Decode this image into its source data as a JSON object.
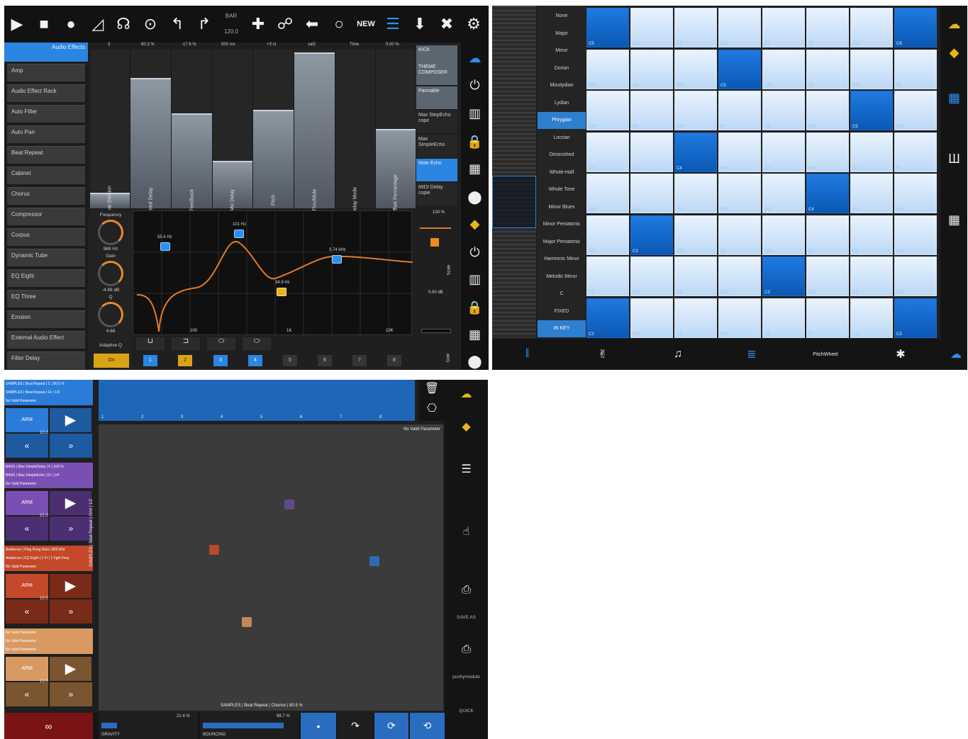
{
  "panel1": {
    "toolbar": {
      "play": "▶",
      "stop": "■",
      "record": "●",
      "metronome": "◿",
      "headphones": "☊",
      "play_circle": "⊙",
      "undo": "↰",
      "redo": "↱",
      "tempo_label": "BAR",
      "tempo_value": "120.0",
      "add": "✚",
      "link": "☍",
      "back": "⬅",
      "circle": "○",
      "new": "NEW",
      "list": "☰",
      "download": "⬇",
      "close": "✖",
      "settings": "⚙"
    },
    "device_list": {
      "header": "Audio Effects",
      "items": [
        "Amp",
        "Audio Effect Rack",
        "Auto Filter",
        "Auto Pan",
        "Beat Repeat",
        "Cabinet",
        "Chorus",
        "Compressor",
        "Corpus",
        "Dynamic Tube",
        "EQ Eight",
        "EQ Three",
        "Erosion",
        "External Audio Effect",
        "Filter Delay"
      ]
    },
    "param_values": [
      "3",
      "80.3 %",
      "-17.6 %",
      "500 ms",
      "+3 st",
      "val2",
      "Time",
      "0.00 %"
    ],
    "param_names": [
      "Beat Division",
      "Feed Delay",
      "Feedback",
      "Mix Delay",
      "Pitch",
      "Thru/Mute",
      "Delay Mode",
      "Beat Offset Percentage"
    ],
    "param_levels": [
      0.1,
      0.82,
      0.6,
      0.3,
      0.62,
      0.98,
      0.0,
      0.5
    ],
    "side_buttons": [
      "KICK",
      "THEME COMPOSER",
      "Pannable",
      "Max StepEcho cope",
      "Max SimpleEcho",
      "Note Echo",
      "MIDI Delay copie"
    ],
    "knobs": [
      {
        "label": "Frequency",
        "value": "969 Hz"
      },
      {
        "label": "Gain",
        "value": "-4.98 dB"
      },
      {
        "label": "Q",
        "value": "4.66"
      }
    ],
    "adaptive": "Adaptive Q",
    "eq_labels": {
      "f1": "55.4 Hz",
      "f2": "101 Hz",
      "f3": "34.9 Hz",
      "f4": "3.74 kHz",
      "x100": "100",
      "x1k": "1K",
      "x10k": "10K"
    },
    "right_values": {
      "top": "100 %",
      "mid": "0.00 dB",
      "scale": "Scale",
      "gain": "Gain"
    },
    "filter_icons": [
      "⊔",
      "⊐",
      "⬭",
      "⬭"
    ],
    "band_numbers": [
      "1",
      "2",
      "3",
      "4",
      "5",
      "6",
      "7",
      "8"
    ],
    "on_label": "On",
    "side_icons": [
      "☁",
      "⏻",
      "▥",
      "🔒",
      "▦",
      "⬤",
      "◆",
      "⏻",
      "▥",
      "🔒",
      "▦",
      "⬤"
    ]
  },
  "panel2": {
    "scales": [
      "None",
      "Major",
      "Minor",
      "Dorian",
      "Mixolydian",
      "Lydian",
      "Phrygian",
      "Locrian",
      "Diminished",
      "Whole-Half",
      "Whole Tone",
      "Minor Blues",
      "Minor Pentatonic",
      "Major Pentatonic",
      "Harmonic Minor",
      "Melodic Minor",
      "C",
      "FIXED",
      "IN KEY"
    ],
    "selected_scale": "Phrygian",
    "grid_rows": [
      [
        "C5",
        "C#5",
        "D5",
        "D#5",
        "E5",
        "F5",
        "F#5",
        "C6"
      ],
      [
        "F#4",
        "G4",
        "G#4",
        "C5",
        "C#5",
        "D5",
        "D#5",
        "E5"
      ],
      [
        "C#4",
        "D4",
        "D#4",
        "E4",
        "F4",
        "F#4",
        "C5",
        "G#4"
      ],
      [
        "G#3",
        "A3",
        "C4",
        "C#4",
        "D4",
        "D#4",
        "E4",
        "F4"
      ],
      [
        "D#3",
        "E3",
        "F3",
        "F#3",
        "G3",
        "C4",
        "A3",
        "A#3"
      ],
      [
        "A#2",
        "C3",
        "C#3",
        "D3",
        "D#3",
        "E3",
        "F3",
        "F#3"
      ],
      [
        "F2",
        "F#2",
        "G2",
        "G#2",
        "C3",
        "A#2",
        "B2",
        "C#3"
      ],
      [
        "C2",
        "C#2",
        "D2",
        "D#2",
        "E2",
        "F2",
        "F#2",
        "C3"
      ]
    ],
    "on_cells": [
      [
        0,
        0
      ],
      [
        0,
        7
      ],
      [
        1,
        3
      ],
      [
        2,
        6
      ],
      [
        3,
        2
      ],
      [
        4,
        5
      ],
      [
        5,
        1
      ],
      [
        6,
        4
      ],
      [
        7,
        0
      ],
      [
        7,
        7
      ]
    ],
    "bottom": [
      "𝄃",
      "✌",
      "♫",
      "≣",
      "PitchWheel",
      "✱",
      "☁"
    ],
    "right_icons": [
      "☁",
      "◆",
      "▦",
      "Ш",
      "▦"
    ]
  },
  "panel3": {
    "tracks": [
      {
        "line1": "SAMPLES | Beat Repeat | C | 80.5 %",
        "line2": "SAMPLES | Beat Repeat | Gr | 1/2",
        "line3": "No Valid Parameter",
        "arm": "ARM",
        "val": "10.2",
        "color": "#2a7cd8",
        "dark": "#1d5aa0"
      },
      {
        "line1": "BASS | Max SimpleDelay | F | 100 %",
        "line2": "BASS | Max SimpleEcho | Dr | 1/4",
        "line3": "No Valid Parameter",
        "arm": "ARM",
        "val": "21.0",
        "color": "#7a4fb4",
        "dark": "#4b2f72"
      },
      {
        "line1": "Ambience | Ping Pong Dela | 800 kHz",
        "line2": "Ambience | EQ Eight | 1 Fr | 1 Fght Freq",
        "line3": "No Valid Parameter",
        "arm": "ARM",
        "val": "10.0",
        "color": "#c4482a",
        "dark": "#7a2a18"
      },
      {
        "line1": "No Valid Parameter",
        "line2": "No Valid Parameter",
        "line3": "No Valid Parameter",
        "arm": "ARM",
        "val": "21.0",
        "color": "#d89a62",
        "dark": "#7a5530"
      }
    ],
    "ruler": [
      "1",
      "2",
      "3",
      "4",
      "5",
      "6",
      "7",
      "8"
    ],
    "pad_top": "No Valid Parameter",
    "pad_left": "SAMPLES | Beat Repeat | Grid | 1/2",
    "pad_bottom": "SAMPLES | Beat Repeat | Chance | 80.5 %",
    "bottom": {
      "loop": "∞",
      "gravity": "GRAVITY",
      "gravity_val": "21.4 %",
      "bouncing": "BOUNCING",
      "bouncing_val": "98.7 %"
    },
    "right": {
      "save_as": "SAVE AS",
      "user": "pushymodule",
      "quick": "QUICK"
    }
  }
}
